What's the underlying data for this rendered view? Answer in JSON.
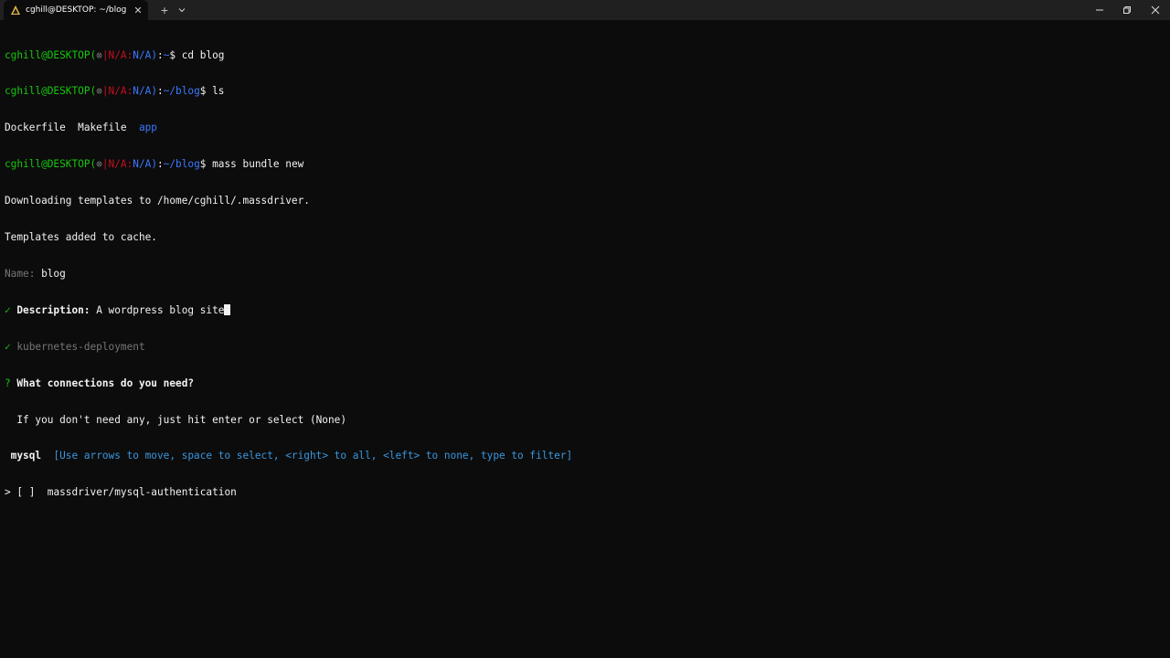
{
  "window": {
    "tab_title": "cghill@DESKTOP: ~/blog",
    "tab_icon": "terminal-icon",
    "close_tab_label": "✕",
    "new_tab_label": "+",
    "dropdown_label": "⌄"
  },
  "terminal": {
    "l1": {
      "user": "cghill@DESKTOP(",
      "mark": "⊗",
      "na": "|N/A:",
      "na2": "N/A)",
      "sep": ":",
      "path": "~",
      "cmd": "$ cd blog"
    },
    "l2": {
      "user": "cghill@DESKTOP(",
      "mark": "⊗",
      "na": "|N/A:",
      "na2": "N/A)",
      "sep": ":",
      "path": "~/blog",
      "cmd": "$ ls"
    },
    "l3": {
      "f1": "Dockerfile  Makefile  ",
      "f2": "app"
    },
    "l4": {
      "user": "cghill@DESKTOP(",
      "mark": "⊗",
      "na": "|N/A:",
      "na2": "N/A)",
      "sep": ":",
      "path": "~/blog",
      "cmd": "$ mass bundle new"
    },
    "l5": "Downloading templates to /home/cghill/.massdriver.",
    "l6": "Templates added to cache.",
    "l7": {
      "label": "Name: ",
      "value": "blog"
    },
    "l8": {
      "check": "✓ ",
      "label": "Description: ",
      "value": "A wordpress blog site"
    },
    "l9": {
      "check": "✓ ",
      "value": "kubernetes-deployment"
    },
    "l10": {
      "q": "? ",
      "text": "What connections do you need?"
    },
    "l11": "  If you don't need any, just hit enter or select (None)",
    "l12": {
      "name": " mysql  ",
      "hint": "[Use arrows to move, space to select, <right> to all, <left> to none, type to filter]"
    },
    "l13": {
      "arrow": "> ",
      "box": "[ ]",
      "item": "  massdriver/mysql-authentication"
    }
  }
}
